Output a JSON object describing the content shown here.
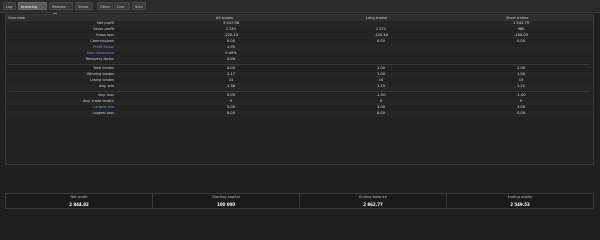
{
  "tabs": [
    {
      "label": "Log",
      "active": false
    },
    {
      "label": "Invoicing",
      "active": true
    },
    {
      "label": "Restore",
      "active": false,
      "check": true
    },
    {
      "label": "Share",
      "active": false
    },
    {
      "label": "Other",
      "active": false
    },
    {
      "label": "Live",
      "active": false
    },
    {
      "label": "Sum",
      "active": false
    }
  ],
  "table": {
    "headers": [
      "Overview",
      "All trades",
      "Long trades",
      "Short trades"
    ],
    "rows": [
      {
        "label": "Net profit",
        "values": [
          "3 547.96",
          "",
          "1 543.79"
        ]
      },
      {
        "label": "Gross profit",
        "values": [
          "2 251",
          "1 271",
          "980"
        ]
      },
      {
        "label": "Gross loss",
        "values": [
          "-220.13",
          "-120.10",
          "-100.03"
        ]
      },
      {
        "label": "Commissions",
        "values": [
          "0.00",
          "0.00",
          "0.00"
        ]
      },
      {
        "label": "Profit factor",
        "values": [
          "1.95",
          "",
          ""
        ]
      },
      {
        "label": "Max drawdown",
        "values": [
          "0.00%",
          "",
          ""
        ]
      },
      {
        "label": "Recovery factor",
        "values": [
          "0.00",
          "",
          ""
        ]
      },
      {
        "label": "Total trades",
        "values": [
          "4.00",
          "1.00",
          "2.00"
        ]
      },
      {
        "label": "Winning trades",
        "values": [
          "2.17",
          "1.00",
          "1.00"
        ]
      },
      {
        "label": "Losing trades",
        "values": [
          "14",
          "10",
          "15"
        ]
      },
      {
        "label": "Avg. win",
        "values": [
          "1.38",
          "1.15",
          "1.21"
        ]
      },
      {
        "label": "Avg. loss",
        "values": [
          "0.00",
          "-1.00",
          "-1.00"
        ]
      },
      {
        "label": "Avg. trade length",
        "values": [
          "0",
          "0",
          "0"
        ]
      },
      {
        "label": "Largest win",
        "values": [
          "5.00",
          "3.00",
          "3.00"
        ]
      },
      {
        "label": "Largest loss",
        "values": [
          "0.00",
          "0.00",
          "0.00"
        ]
      }
    ]
  },
  "footer": [
    {
      "label": "Net profit",
      "value": "2 844.82"
    },
    {
      "label": "Starting capital",
      "value": "100 000"
    },
    {
      "label": "Ending balance",
      "value": "2 862.77"
    },
    {
      "label": "Ending equity",
      "value": "2 549.53"
    }
  ]
}
